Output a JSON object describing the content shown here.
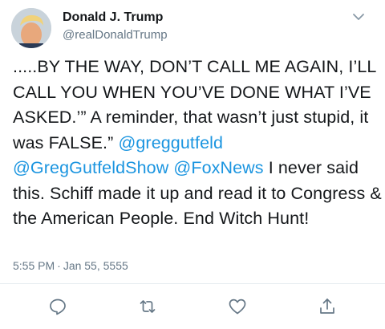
{
  "user": {
    "name": "Donald J. Trump",
    "handle": "@realDonaldTrump"
  },
  "tweet": {
    "text_1": ".....BY THE WAY, DON’T CALL ME AGAIN, I’LL CALL YOU WHEN YOU’VE DONE WHAT I’VE ASKED.’” A reminder, that wasn’t just stupid, it was FALSE.” ",
    "mention_1": "@greggutfeld",
    "space_1": " ",
    "mention_2": "@GregGutfeldShow",
    "space_2": " ",
    "mention_3": "@FoxNews",
    "text_2": " I never said this. Schiff made it up and read it to Congress & the American People. End Witch Hunt!"
  },
  "timestamp": {
    "time": "5:55 PM",
    "separator": "·",
    "date": "Jan 55, 5555"
  },
  "colors": {
    "link": "#1b95e0",
    "secondary_text": "#657786",
    "icon": "#657786"
  },
  "icons": {
    "caret": "chevron-down-icon",
    "reply": "reply-icon",
    "retweet": "retweet-icon",
    "like": "heart-icon",
    "share": "share-icon"
  }
}
